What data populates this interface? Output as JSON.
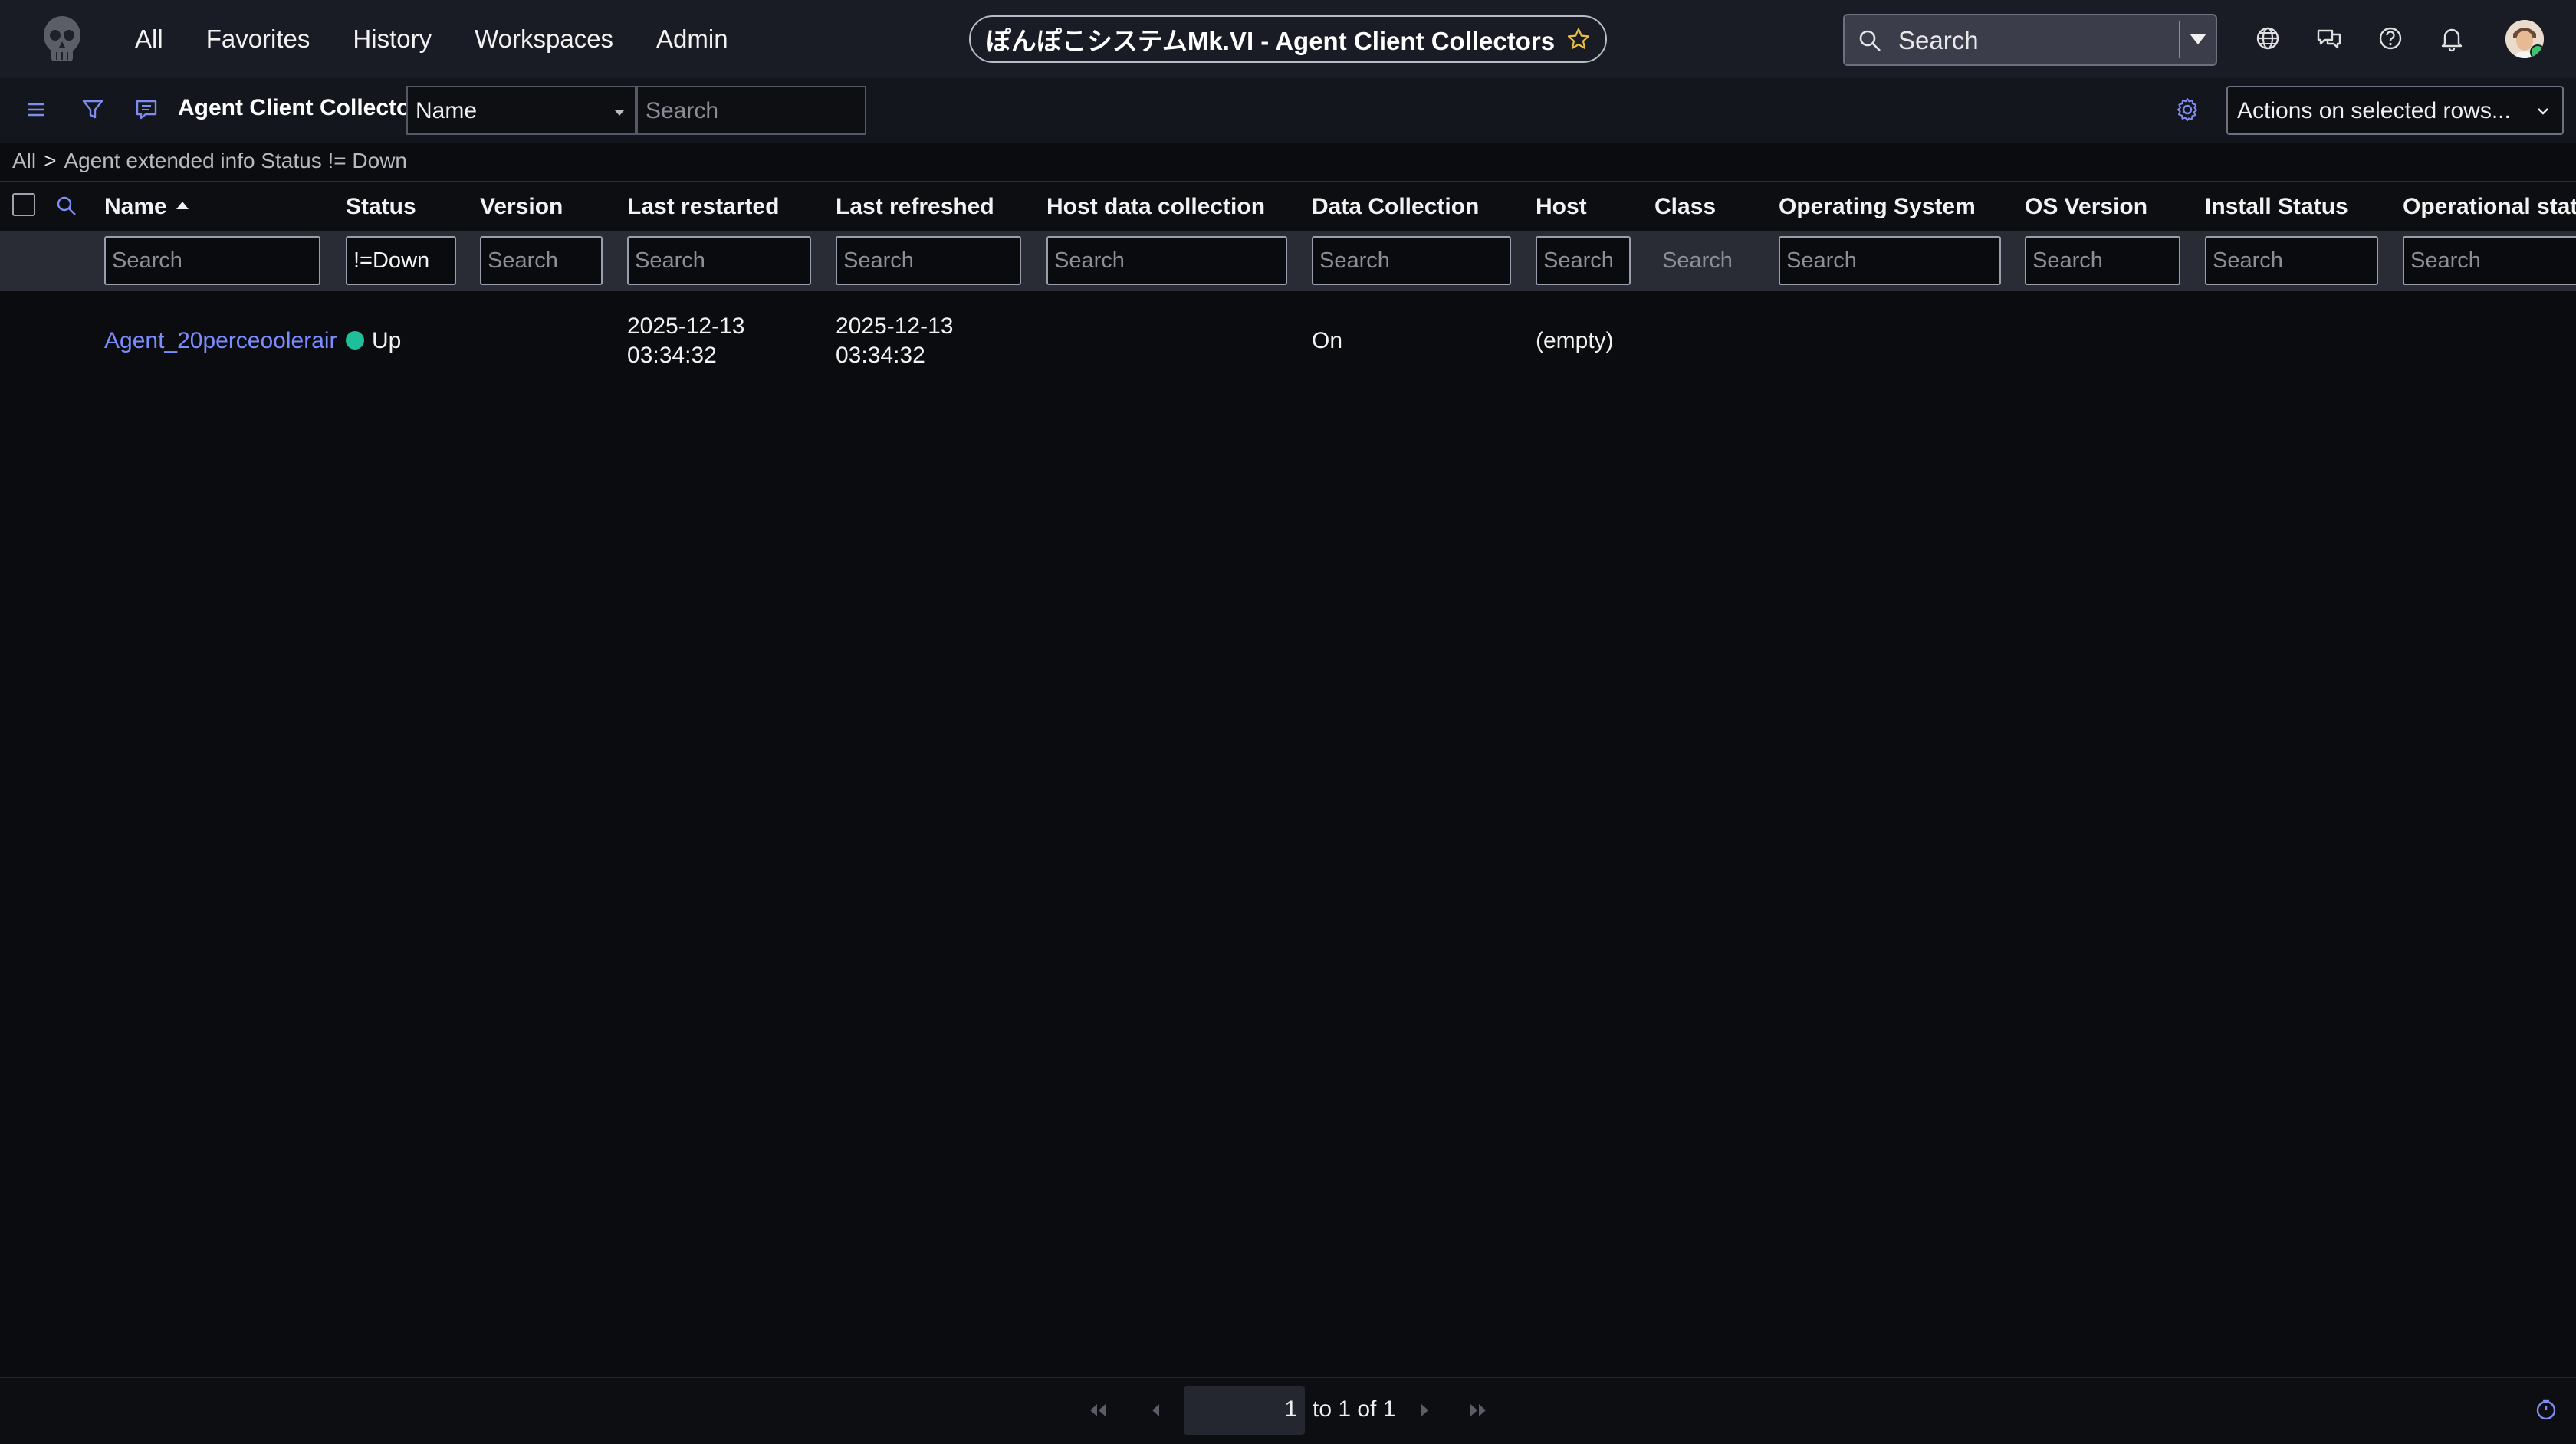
{
  "topnav": {
    "menu": [
      "All",
      "Favorites",
      "History",
      "Workspaces",
      "Admin"
    ],
    "title": "ぽんぽこシステムMk.VI - Agent Client Collectors",
    "search_placeholder": "Search"
  },
  "toolbar": {
    "list_title": "Agent Client Collectors",
    "field_select": "Name",
    "search_placeholder": "Search",
    "actions_label": "Actions on selected rows..."
  },
  "breadcrumb": {
    "root": "All",
    "separator": ">",
    "filter": "Agent extended info Status != Down"
  },
  "table": {
    "columns": [
      "Name",
      "Status",
      "Version",
      "Last restarted",
      "Last refreshed",
      "Host data collection",
      "Data Collection",
      "Host",
      "Class",
      "Operating System",
      "OS Version",
      "Install Status",
      "Operational status"
    ],
    "filters": [
      "Search",
      "!=Down",
      "Search",
      "Search",
      "Search",
      "Search",
      "Search",
      "Search",
      "Search",
      "Search",
      "Search",
      "Search",
      "Search"
    ],
    "rows": [
      {
        "name": "Agent_20perceoolerair",
        "status": "Up",
        "last_restarted": [
          "2025-12-13",
          "03:34:32"
        ],
        "last_refreshed": [
          "2025-12-13",
          "03:34:32"
        ],
        "data_collection": "On",
        "host": "(empty)"
      }
    ],
    "status_color": "#1fbf9a",
    "link_color": "#7b8cff"
  },
  "pagination": {
    "current_page": "1",
    "info": "to 1 of 1"
  }
}
